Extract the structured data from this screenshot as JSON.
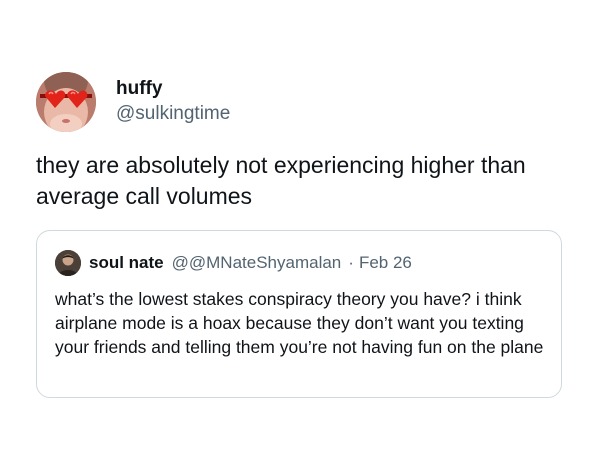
{
  "tweet": {
    "display_name": "huffy",
    "handle": "@sulkingtime",
    "text": "they are absolutely not experiencing higher than average call volumes",
    "avatar_icon": "person-with-red-heart-sunglasses"
  },
  "quoted_tweet": {
    "display_name": "soul nate",
    "handle": "@@MNateShyamalan",
    "separator": "·",
    "date": "Feb 26",
    "text": "what’s the lowest stakes conspiracy theory you have? i think airplane mode is a hoax because they don’t want you texting your friends and telling them you’re not having fun on the plane",
    "avatar_icon": "person-avatar"
  },
  "colors": {
    "primary_text": "#0f1419",
    "secondary_text": "#536471",
    "border": "#cfd9de",
    "sunglasses_red": "#e2231a"
  }
}
